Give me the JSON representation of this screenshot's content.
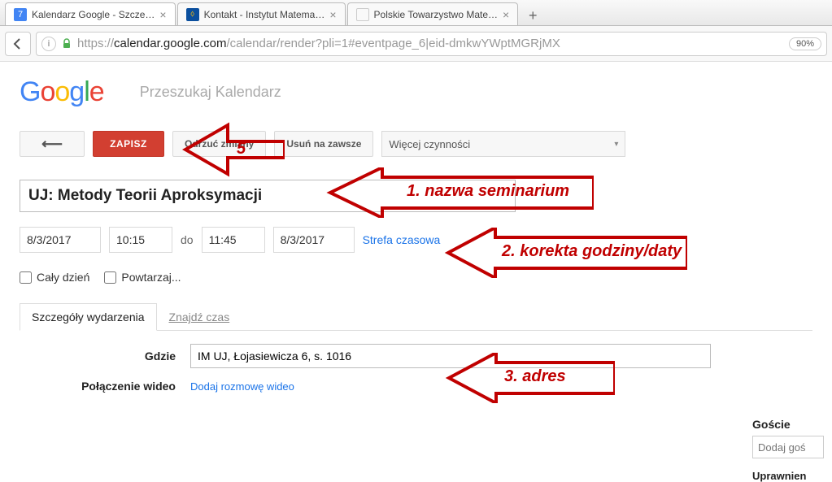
{
  "browser": {
    "tabs": [
      {
        "title": "Kalendarz Google - Szcze…",
        "icon_bg": "#4285F4",
        "icon_txt": "7",
        "active": true
      },
      {
        "title": "Kontakt - Instytut Matema…",
        "icon_bg": "#0b4f9e",
        "icon_txt": "⬨",
        "active": false
      },
      {
        "title": "Polskie Towarzystwo Mate…",
        "icon_bg": "#fff",
        "icon_txt": "",
        "active": false
      }
    ],
    "url_display": "https://calendar.google.com/calendar/render?pli=1#eventpage_6|eid-dmkwYWptMGRjMX",
    "zoom": "90%"
  },
  "logo_letters": [
    "G",
    "o",
    "o",
    "g",
    "l",
    "e"
  ],
  "search": {
    "placeholder": "Przeszukaj Kalendarz"
  },
  "buttons": {
    "back_arrow": "⟵",
    "save": "ZAPISZ",
    "discard": "Odrzuć zmiany",
    "delete": "Usuń na zawsze",
    "more_dropdown": "Więcej czynności",
    "chevron": "▾"
  },
  "event": {
    "title": "UJ: Metody Teorii Aproksymacji",
    "date_start": "8/3/2017",
    "time_start": "10:15",
    "to_label": "do",
    "time_end": "11:45",
    "date_end": "8/3/2017",
    "timezone_link": "Strefa czasowa"
  },
  "checks": {
    "all_day": "Cały dzień",
    "repeat": "Powtarzaj..."
  },
  "tabs": {
    "details": "Szczegóły wydarzenia",
    "find_time": "Znajdź czas"
  },
  "form": {
    "where_label": "Gdzie",
    "where_value": "IM UJ, Łojasiewicza 6, s. 1016",
    "video_label": "Połączenie wideo",
    "video_link": "Dodaj rozmowę wideo"
  },
  "guests": {
    "title": "Goście",
    "placeholder": "Dodaj goś",
    "perms": "Uprawnien"
  },
  "annotations": {
    "a1": "1. nazwa seminarium",
    "a2": "2. korekta godziny/daty",
    "a3": "3. adres",
    "a5": "5"
  }
}
